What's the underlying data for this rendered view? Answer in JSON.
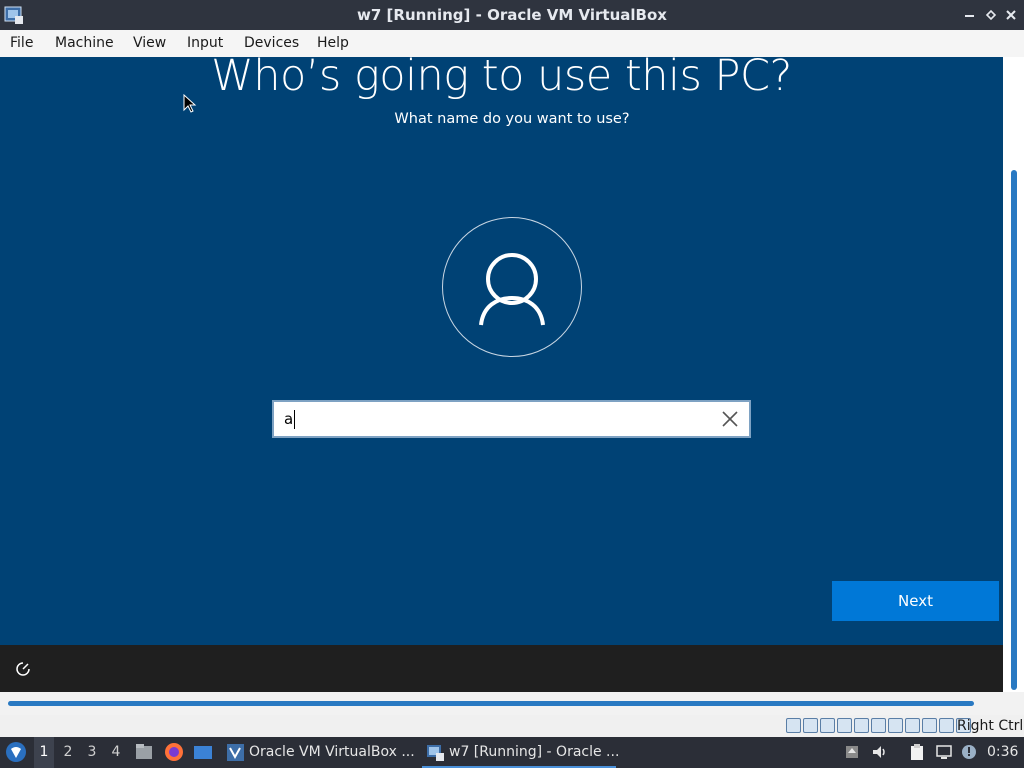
{
  "window": {
    "title": "w7 [Running] - Oracle VM VirtualBox",
    "app_icon": "virtualbox-icon",
    "controls": [
      "minimize-icon",
      "restore-icon",
      "close-icon"
    ]
  },
  "menubar": {
    "items": [
      "File",
      "Machine",
      "View",
      "Input",
      "Devices",
      "Help"
    ]
  },
  "guest": {
    "heading": "Who’s going to use this PC?",
    "subheading": "What name do you want to use?",
    "avatar_icon": "user-icon",
    "name_input": {
      "value": "a",
      "clear_icon": "clear-x-icon"
    },
    "next_label": "Next",
    "ease_of_access_icon": "ease-of-access-icon",
    "colors": {
      "background": "#004275",
      "accent": "#0078d7",
      "bottom_bar": "#1f1f1f"
    }
  },
  "vbox_status": {
    "host_key": "Right Ctrl",
    "indicator_icons": [
      "hard-disk-icon",
      "optical-drive-icon",
      "audio-icon",
      "network-icon",
      "usb-icon",
      "shared-folders-icon",
      "display-icon",
      "video-capture-icon",
      "cpu-icon",
      "mouse-integration-icon",
      "keyboard-icon"
    ]
  },
  "taskbar": {
    "start_icon": "start-menu-icon",
    "workspaces": [
      "1",
      "2",
      "3",
      "4"
    ],
    "launchers": [
      "file-manager-icon",
      "firefox-icon",
      "desktop-icon"
    ],
    "tasks": [
      {
        "label": "Oracle VM VirtualBox ...",
        "icon": "virtualbox-manager-icon"
      },
      {
        "label": "w7 [Running] - Oracle ...",
        "icon": "virtualbox-icon"
      }
    ],
    "tray_icons": [
      "update-notifier-icon",
      "volume-icon",
      "clipboard-icon",
      "network-wired-icon",
      "notifications-icon"
    ],
    "clock": "0:36"
  }
}
